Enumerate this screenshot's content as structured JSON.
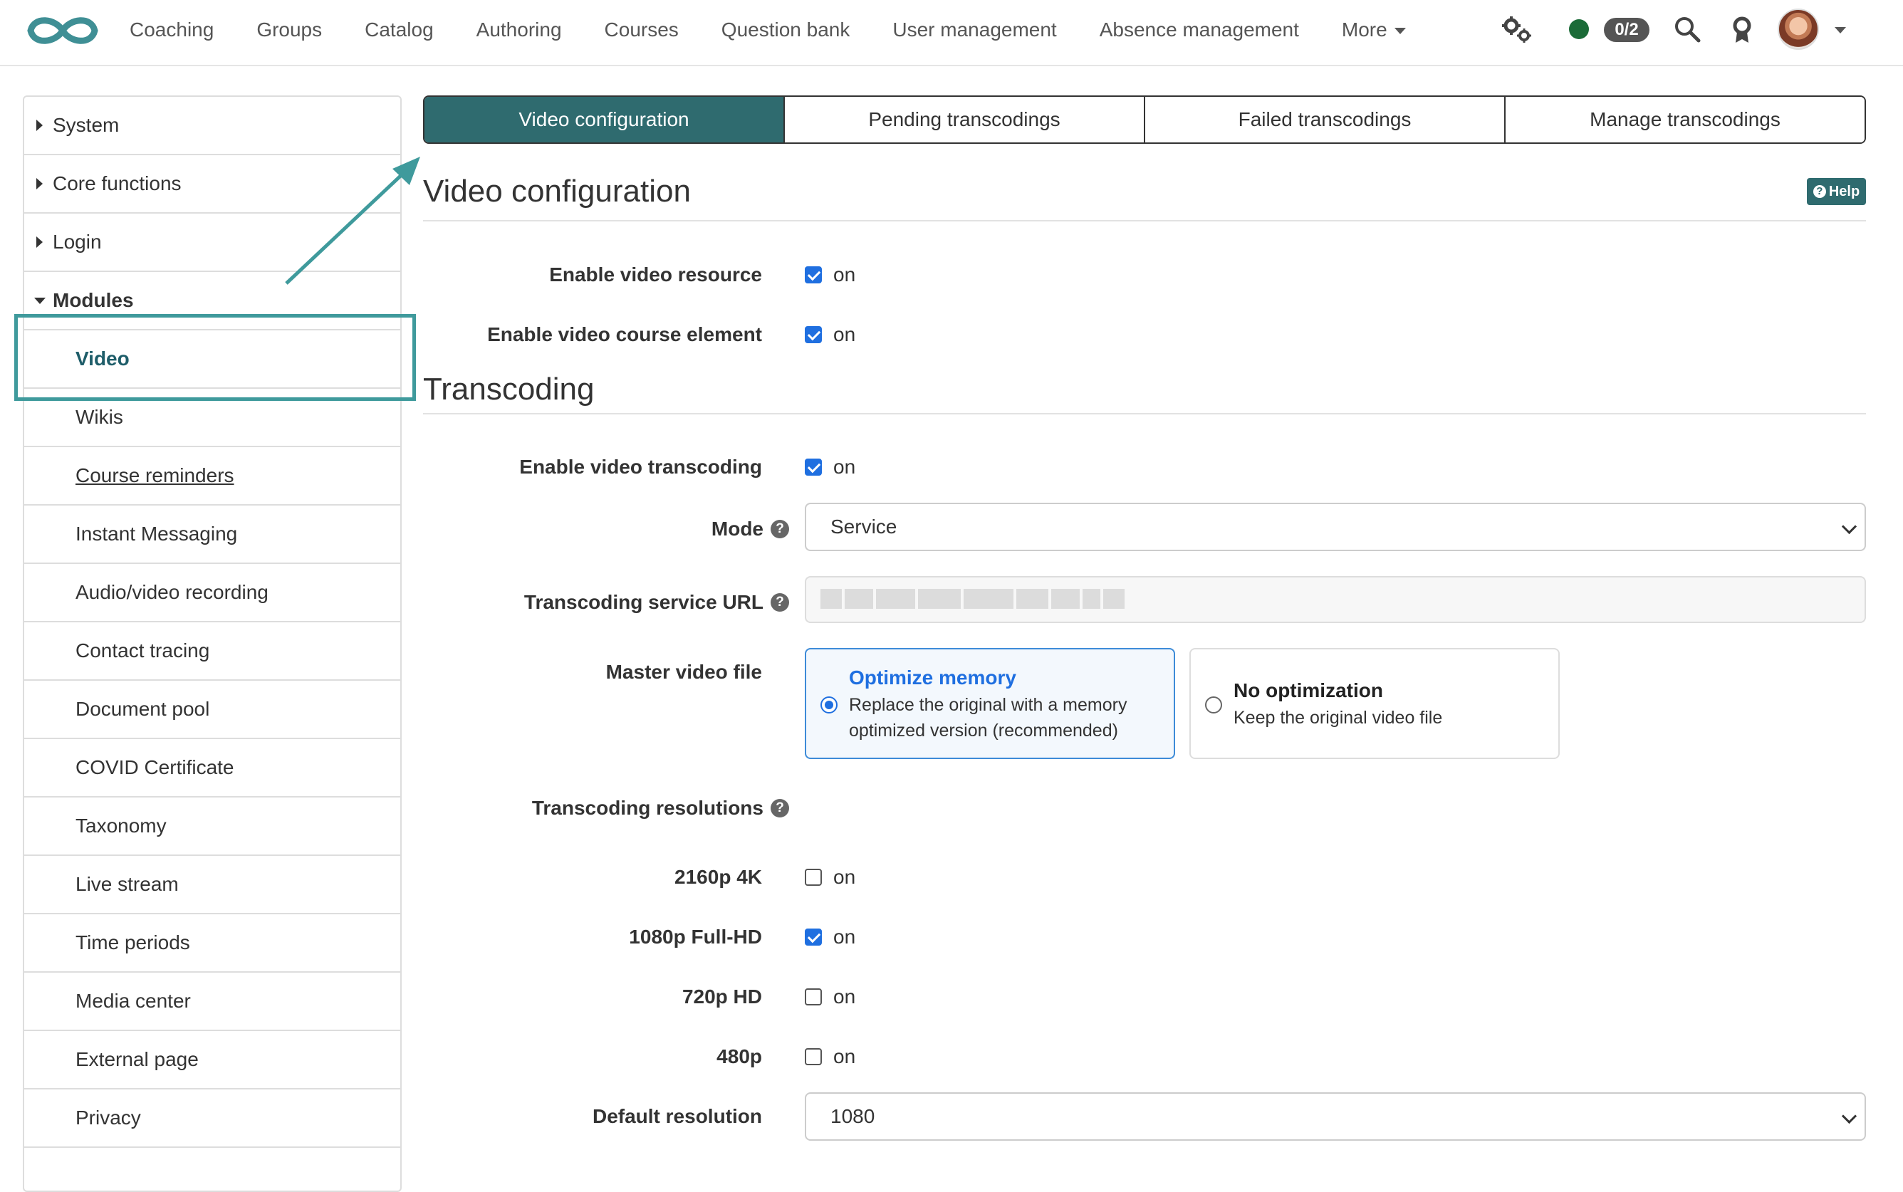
{
  "nav": {
    "links": [
      "Coaching",
      "Groups",
      "Catalog",
      "Authoring",
      "Courses",
      "Question bank",
      "User management",
      "Absence management",
      "More"
    ],
    "badge": "0/2"
  },
  "sidebar": {
    "items": [
      {
        "label": "System"
      },
      {
        "label": "Core functions"
      },
      {
        "label": "Login"
      },
      {
        "label": "Modules"
      },
      {
        "label": "Video"
      },
      {
        "label": "Wikis"
      },
      {
        "label": "Course reminders"
      },
      {
        "label": "Instant Messaging"
      },
      {
        "label": "Audio/video recording"
      },
      {
        "label": "Contact tracing"
      },
      {
        "label": "Document pool"
      },
      {
        "label": "COVID Certificate"
      },
      {
        "label": "Taxonomy"
      },
      {
        "label": "Live stream"
      },
      {
        "label": "Time periods"
      },
      {
        "label": "Media center"
      },
      {
        "label": "External page"
      },
      {
        "label": "Privacy"
      }
    ]
  },
  "tabs": [
    "Video configuration",
    "Pending transcodings",
    "Failed transcodings",
    "Manage transcodings"
  ],
  "main": {
    "title": "Video configuration",
    "help": "Help",
    "enable_resource_label": "Enable video resource",
    "enable_course_element_label": "Enable video course element",
    "on_text": "on",
    "transcoding_title": "Transcoding",
    "enable_transcoding_label": "Enable video transcoding",
    "mode_label": "Mode",
    "mode_value": "Service",
    "service_url_label": "Transcoding service URL",
    "master_label": "Master video file",
    "opt_memory_title": "Optimize memory",
    "opt_memory_desc": "Replace the original with a memory optimized version (recommended)",
    "no_opt_title": "No optimization",
    "no_opt_desc": "Keep the original video file",
    "resolutions_label": "Transcoding resolutions",
    "res_4k": "2160p 4K",
    "res_1080": "1080p Full-HD",
    "res_720": "720p HD",
    "res_480": "480p",
    "default_res_label": "Default resolution",
    "default_res_value": "1080"
  },
  "colors": {
    "accent": "#2f6b6f",
    "highlight": "#3f9a9c",
    "checkbox": "#1f6fe0",
    "status": "#1b6b38"
  }
}
